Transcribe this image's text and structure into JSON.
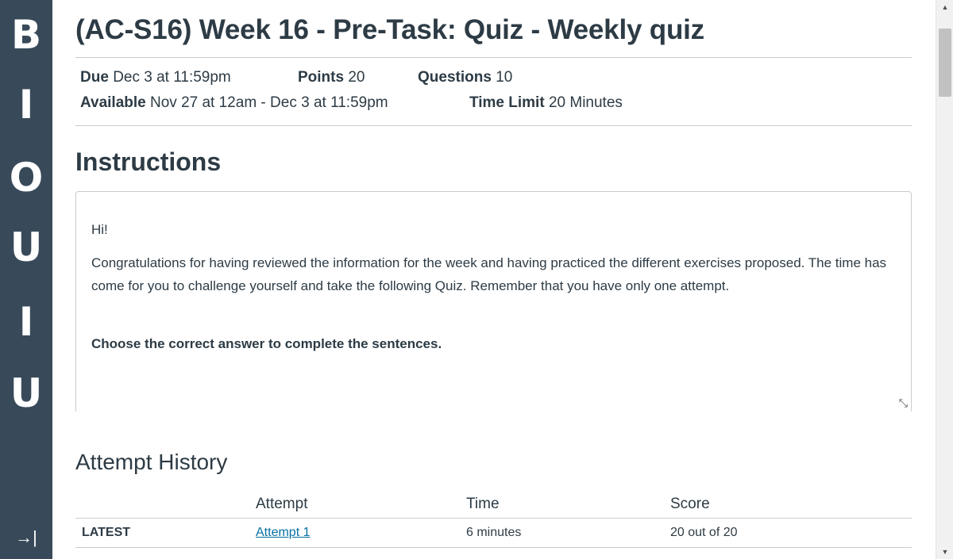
{
  "leftnav": {
    "letters": [
      "B",
      "I",
      "O",
      "U",
      "I",
      "U"
    ],
    "collapse_icon": "→|"
  },
  "quiz": {
    "title": "(AC-S16) Week 16 - Pre-Task: Quiz - Weekly quiz",
    "due_label": "Due",
    "due_value": "Dec 3 at 11:59pm",
    "points_label": "Points",
    "points_value": "20",
    "questions_label": "Questions",
    "questions_value": "10",
    "available_label": "Available",
    "available_value": "Nov 27 at 12am - Dec 3 at 11:59pm",
    "time_limit_label": "Time Limit",
    "time_limit_value": "20 Minutes"
  },
  "instructions": {
    "heading": "Instructions",
    "greeting": "Hi!",
    "body": "Congratulations for having reviewed the information for the week and having practiced the different exercises proposed. The time has come for you to challenge yourself and take the following Quiz. Remember that you have only one attempt.",
    "emphasis": "Choose the correct answer to complete the sentences."
  },
  "attempt_history": {
    "heading": "Attempt History",
    "columns": [
      "",
      "Attempt",
      "Time",
      "Score"
    ],
    "rows": [
      {
        "label": "LATEST",
        "attempt": "Attempt 1",
        "time": "6 minutes",
        "score": "20 out of 20"
      }
    ]
  },
  "scrollbar": {
    "up_icon": "▲",
    "down_icon": "▼"
  }
}
